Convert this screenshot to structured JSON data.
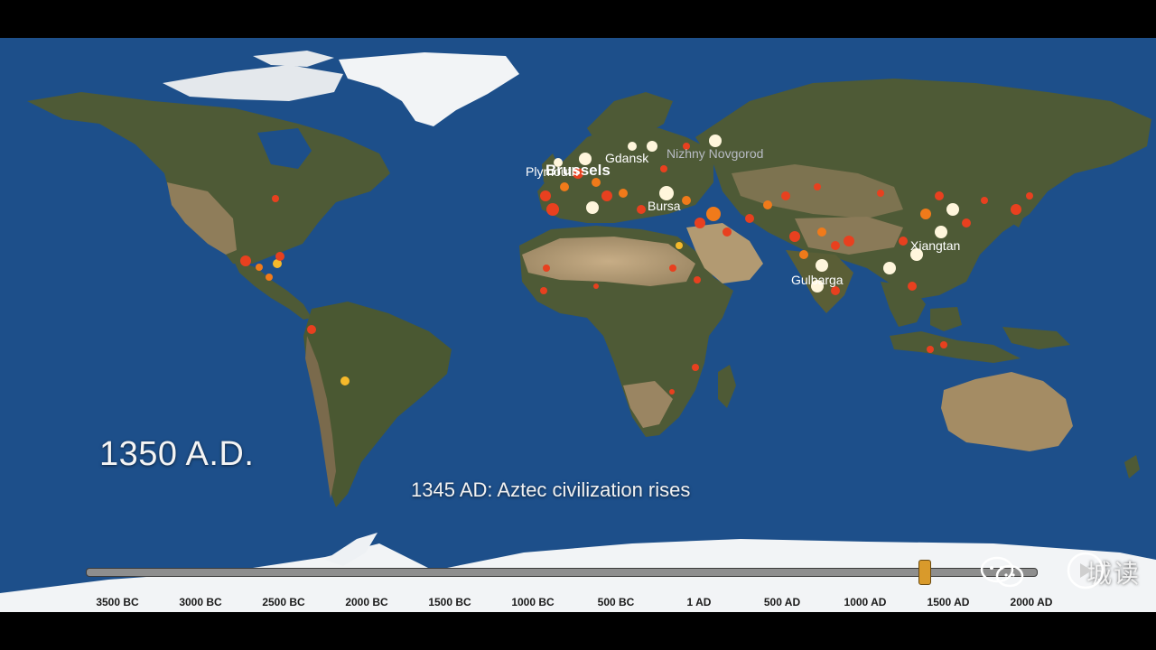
{
  "year": "1350 A.D.",
  "event": "1345 AD: Aztec civilization rises",
  "cities": [
    {
      "name": "Gdansk",
      "lon": 18.6,
      "lat": 54.4
    },
    {
      "name": "Brussels",
      "lon": 4.4,
      "lat": 50.8
    },
    {
      "name": "Plymouth",
      "lon": -4.1,
      "lat": 50.4
    },
    {
      "name": "Nizhny Novgorod",
      "lon": 44.0,
      "lat": 56.3
    },
    {
      "name": "Bursa",
      "lon": 29.1,
      "lat": 40.2
    },
    {
      "name": "Xiangtan",
      "lon": 112.9,
      "lat": 27.8
    },
    {
      "name": "Gulbarga",
      "lon": 76.8,
      "lat": 17.3
    }
  ],
  "timeline": {
    "ticks": [
      "3500 BC",
      "3000 BC",
      "2500 BC",
      "2000 BC",
      "1500 BC",
      "1000 BC",
      "500 BC",
      "1 AD",
      "500 AD",
      "1000 AD",
      "1500 AD",
      "2000 AD"
    ],
    "start_year": -3700,
    "end_year": 2000,
    "current_year": 1350
  },
  "watermark": {
    "text": "城读",
    "icon": "wechat-icon"
  },
  "replay": {
    "icon": "replay-icon"
  },
  "colors": {
    "ocean": "#1d4f8a",
    "land": "#4e5a36",
    "desert": "#b69a72",
    "ice": "#f2f4f6",
    "dot_red": "#e8401f",
    "dot_orange": "#f07a1a",
    "dot_yellow": "#f5b92b",
    "dot_white": "#fff6dc",
    "handle": "#d99a2b"
  }
}
